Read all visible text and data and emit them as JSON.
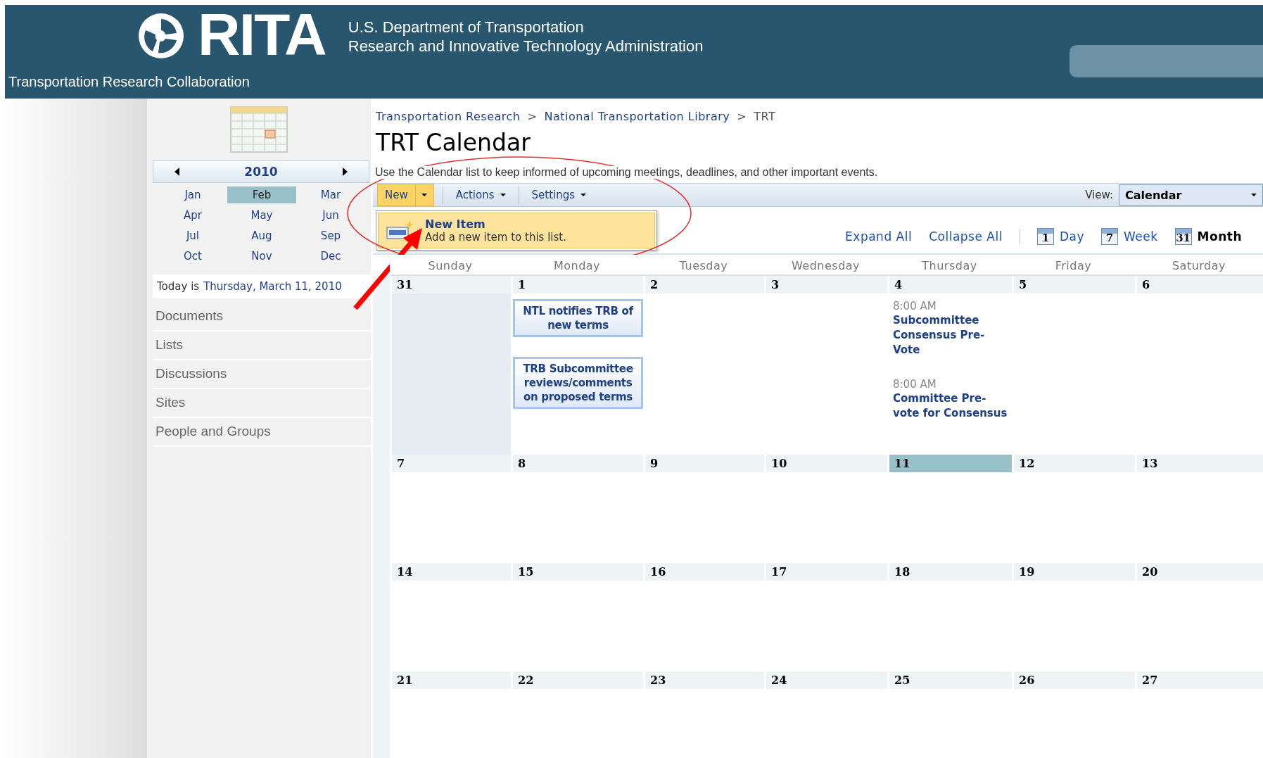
{
  "header": {
    "logo_text": "RITA",
    "department": "U.S. Department of Transportation",
    "agency": "Research and Innovative Technology Administration",
    "site_title": "Transportation Research Collaboration"
  },
  "sidebar": {
    "year": "2010",
    "months": [
      {
        "label": "Jan",
        "selected": false
      },
      {
        "label": "Feb",
        "selected": true
      },
      {
        "label": "Mar",
        "selected": false
      },
      {
        "label": "Apr",
        "selected": false
      },
      {
        "label": "May",
        "selected": false
      },
      {
        "label": "Jun",
        "selected": false
      },
      {
        "label": "Jul",
        "selected": false
      },
      {
        "label": "Aug",
        "selected": false
      },
      {
        "label": "Sep",
        "selected": false
      },
      {
        "label": "Oct",
        "selected": false
      },
      {
        "label": "Nov",
        "selected": false
      },
      {
        "label": "Dec",
        "selected": false
      }
    ],
    "today_prefix": "Today is",
    "today_date": "Thursday, March 11, 2010",
    "nav_items": [
      "Documents",
      "Lists",
      "Discussions",
      "Sites",
      "People and Groups"
    ]
  },
  "breadcrumb": [
    {
      "label": "Transportation Research",
      "link": true
    },
    {
      "label": "National Transportation Library",
      "link": true
    },
    {
      "label": "TRT",
      "link": false
    }
  ],
  "breadcrumb_separator": ">",
  "title": "TRT Calendar",
  "description": "Use the Calendar list to keep informed of upcoming meetings, deadlines, and other important events.",
  "toolbar": {
    "new_label": "New",
    "menus": [
      "Actions",
      "Settings"
    ],
    "view_label": "View:",
    "view_value": "Calendar"
  },
  "new_menu": {
    "items": [
      {
        "title": "New Item",
        "description": "Add a new item to this list."
      }
    ]
  },
  "view_links": [
    "Expand All",
    "Collapse All"
  ],
  "scopes": [
    {
      "icon_label": "1",
      "label": "Day",
      "selected": false
    },
    {
      "icon_label": "7",
      "label": "Week",
      "selected": false
    },
    {
      "icon_label": "31",
      "label": "Month",
      "selected": true
    }
  ],
  "weekdays": [
    "Sunday",
    "Monday",
    "Tuesday",
    "Wednesday",
    "Thursday",
    "Friday",
    "Saturday"
  ],
  "weeks": [
    {
      "days": [
        {
          "number": "31",
          "today": false,
          "outside_month": true
        },
        {
          "number": "1",
          "today": false,
          "outside_month": false,
          "events": [
            {
              "kind": "box",
              "title": "NTL notifies TRB of new terms"
            },
            {
              "kind": "box",
              "title": "TRB Subcommittee reviews/comments on proposed terms"
            }
          ]
        },
        {
          "number": "2",
          "today": false,
          "outside_month": false
        },
        {
          "number": "3",
          "today": false,
          "outside_month": false
        },
        {
          "number": "4",
          "today": false,
          "outside_month": false,
          "events": [
            {
              "kind": "timed",
              "time": "8:00 AM",
              "title": "Subcommittee Consensus Pre-Vote"
            },
            {
              "kind": "timed",
              "time": "8:00 AM",
              "title": "Committee Pre-vote for Consensus"
            }
          ]
        },
        {
          "number": "5",
          "today": false,
          "outside_month": false
        },
        {
          "number": "6",
          "today": false,
          "outside_month": false
        }
      ]
    },
    {
      "days": [
        {
          "number": "7",
          "today": false,
          "outside_month": false
        },
        {
          "number": "8",
          "today": false,
          "outside_month": false
        },
        {
          "number": "9",
          "today": false,
          "outside_month": false
        },
        {
          "number": "10",
          "today": false,
          "outside_month": false
        },
        {
          "number": "11",
          "today": true,
          "outside_month": false
        },
        {
          "number": "12",
          "today": false,
          "outside_month": false
        },
        {
          "number": "13",
          "today": false,
          "outside_month": false
        }
      ]
    },
    {
      "days": [
        {
          "number": "14",
          "today": false,
          "outside_month": false
        },
        {
          "number": "15",
          "today": false,
          "outside_month": false
        },
        {
          "number": "16",
          "today": false,
          "outside_month": false
        },
        {
          "number": "17",
          "today": false,
          "outside_month": false
        },
        {
          "number": "18",
          "today": false,
          "outside_month": false
        },
        {
          "number": "19",
          "today": false,
          "outside_month": false
        },
        {
          "number": "20",
          "today": false,
          "outside_month": false
        }
      ]
    },
    {
      "days": [
        {
          "number": "21",
          "today": false,
          "outside_month": false
        },
        {
          "number": "22",
          "today": false,
          "outside_month": false
        },
        {
          "number": "23",
          "today": false,
          "outside_month": false
        },
        {
          "number": "24",
          "today": false,
          "outside_month": false
        },
        {
          "number": "25",
          "today": false,
          "outside_month": false
        },
        {
          "number": "26",
          "today": false,
          "outside_month": false
        },
        {
          "number": "27",
          "today": false,
          "outside_month": false
        }
      ]
    }
  ]
}
